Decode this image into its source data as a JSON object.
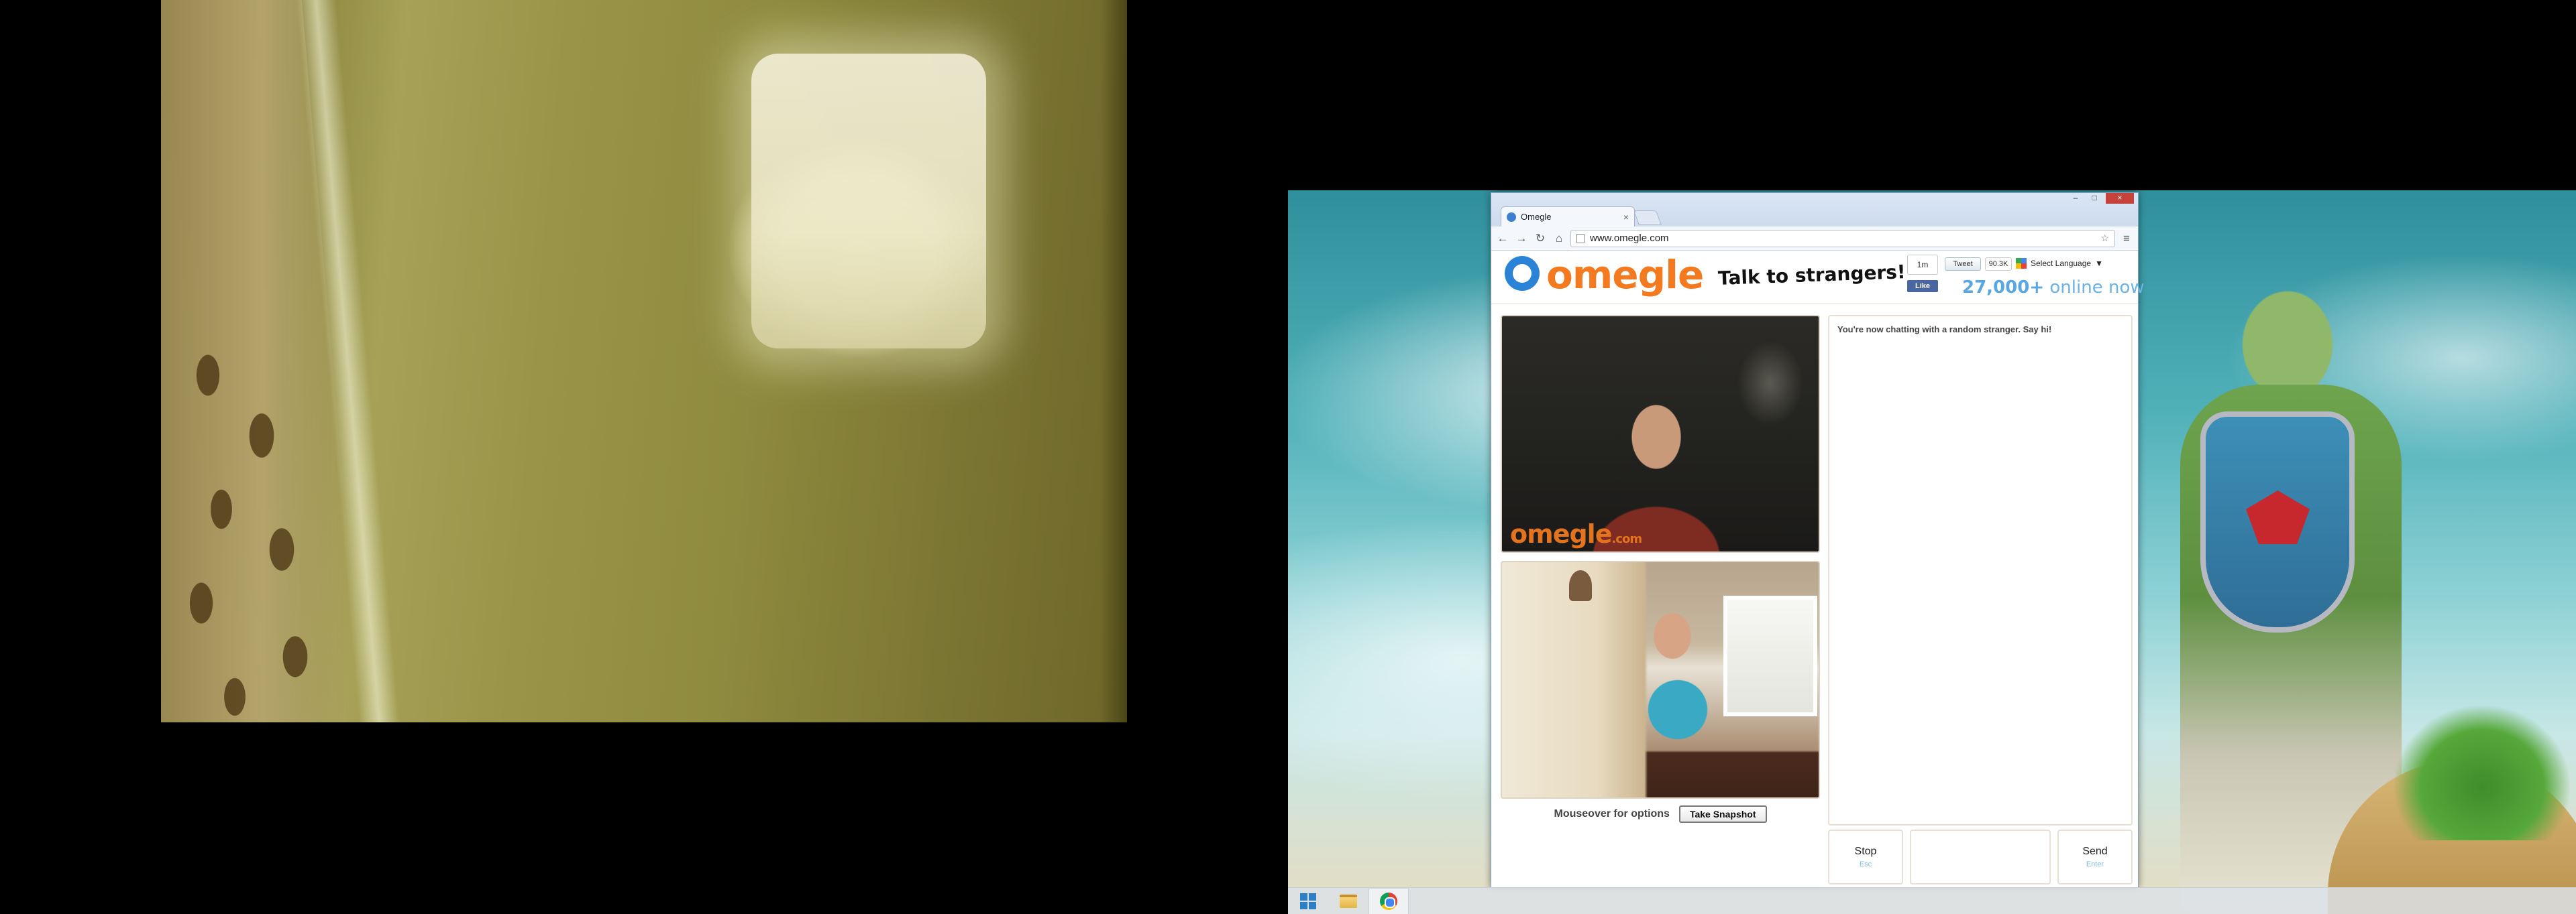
{
  "browser": {
    "tab_title": "Omegle",
    "url": "www.omegle.com",
    "tab_close_glyph": "×",
    "nav": {
      "back_glyph": "←",
      "forward_glyph": "→",
      "reload_glyph": "↻",
      "home_glyph": "⌂",
      "menu_glyph": "≡"
    },
    "window_controls": {
      "minimize": "–",
      "maximize": "□",
      "close": "×"
    }
  },
  "omegle": {
    "logo_text": "omegle",
    "tagline": "Talk to strangers!",
    "social": {
      "plus_count": "1m",
      "like_label": "Like",
      "tweet_label": "Tweet",
      "tweet_count": "90.3K",
      "language_label": "Select Language",
      "language_arrow": "▼"
    },
    "online": {
      "count": "27,000+",
      "suffix": "online now"
    },
    "stranger_video_watermark": "omegle",
    "stranger_video_watermark_suffix": ".com",
    "video_options": {
      "hint": "Mouseover for options",
      "snapshot_label": "Take Snapshot"
    },
    "chat": {
      "status": "You're now chatting with a random stranger. Say hi!"
    },
    "controls": {
      "stop_label": "Stop",
      "stop_key": "Esc",
      "send_label": "Send",
      "send_key": "Enter"
    }
  },
  "icons": {
    "start": "windows-logo-icon",
    "explorer": "file-explorer-icon",
    "chrome": "chrome-icon"
  },
  "colors": {
    "omegle_orange": "#f47a20",
    "omegle_blue": "#2a83d6",
    "online_blue": "#69b3e7"
  }
}
